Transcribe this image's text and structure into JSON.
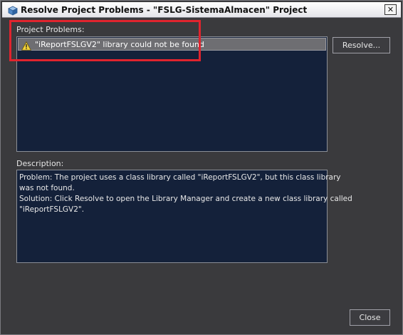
{
  "window": {
    "title": "Resolve Project Problems - \"FSLG-SistemaAlmacen\" Project",
    "close_glyph": "✕"
  },
  "problems": {
    "label": "Project Problems:",
    "items": [
      {
        "text": "\"iReportFSLGV2\" library could not be found",
        "icon": "warning-icon",
        "selected": true
      }
    ]
  },
  "buttons": {
    "resolve": "Resolve...",
    "close": "Close"
  },
  "description": {
    "label": "Description:",
    "lines": [
      "Problem: The project uses a class library called \"iReportFSLGV2\", but this class library",
      "was not found.",
      "Solution: Click Resolve to open the Library Manager and create a new class library called",
      "\"iReportFSLGV2\"."
    ]
  },
  "colors": {
    "background": "#3a3a3d",
    "list_background": "#14213a",
    "selected_row": "#6e6e72",
    "annotation_red": "#e0242e"
  }
}
